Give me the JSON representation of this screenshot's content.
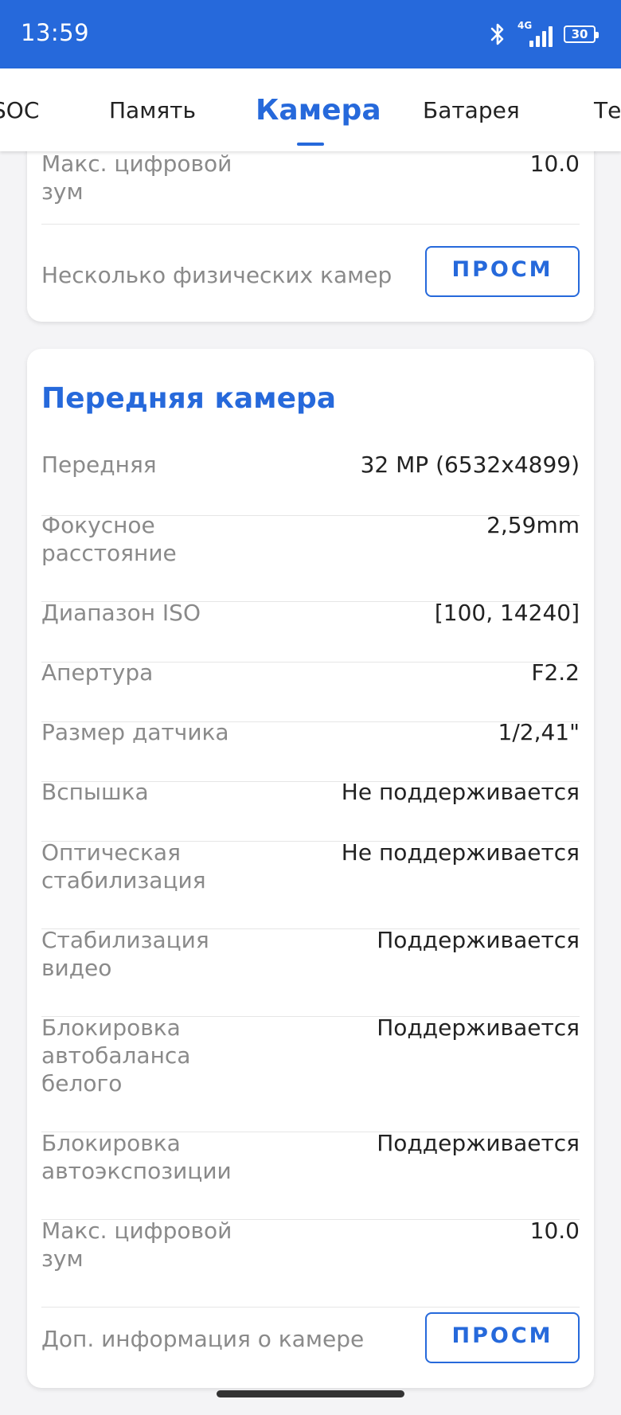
{
  "status_bar": {
    "time": "13:59",
    "network": "4G",
    "battery": "30",
    "icons": [
      "bluetooth-icon",
      "signal-icon",
      "battery-icon"
    ],
    "background_color": "#2669db"
  },
  "tabs": [
    {
      "label": "SOC"
    },
    {
      "label": "Память"
    },
    {
      "label": "Камера",
      "active": true
    },
    {
      "label": "Батарея"
    },
    {
      "label": "Те"
    }
  ],
  "rear_card": {
    "rows": [
      {
        "label": "Макс. цифровой зум",
        "value": "10.0"
      },
      {
        "label": "Несколько физических камер",
        "button": "ПРОСМ"
      }
    ]
  },
  "front_card": {
    "title": "Передняя камера",
    "rows": [
      {
        "label": "Передняя",
        "value": "32 MP (6532x4899)"
      },
      {
        "label": "Фокусное расстояние",
        "value": "2,59mm"
      },
      {
        "label": "Диапазон ISO",
        "value": "[100, 14240]"
      },
      {
        "label": "Апертура",
        "value": "F2.2"
      },
      {
        "label": "Размер датчика",
        "value": "1/2,41\""
      },
      {
        "label": "Вспышка",
        "value": "Не поддерживается"
      },
      {
        "label": "Оптическая стабилизация",
        "value": "Не поддерживается"
      },
      {
        "label": "Стабилизация видео",
        "value": "Поддерживается"
      },
      {
        "label": "Блокировка автобаланса белого",
        "value": "Поддерживается"
      },
      {
        "label": "Блокировка автоэкспозиции",
        "value": "Поддерживается"
      },
      {
        "label": "Макс. цифровой зум",
        "value": "10.0"
      },
      {
        "label": "Доп. информация о камере",
        "button": "ПРОСМ"
      }
    ]
  },
  "accent_color": "#2669db"
}
